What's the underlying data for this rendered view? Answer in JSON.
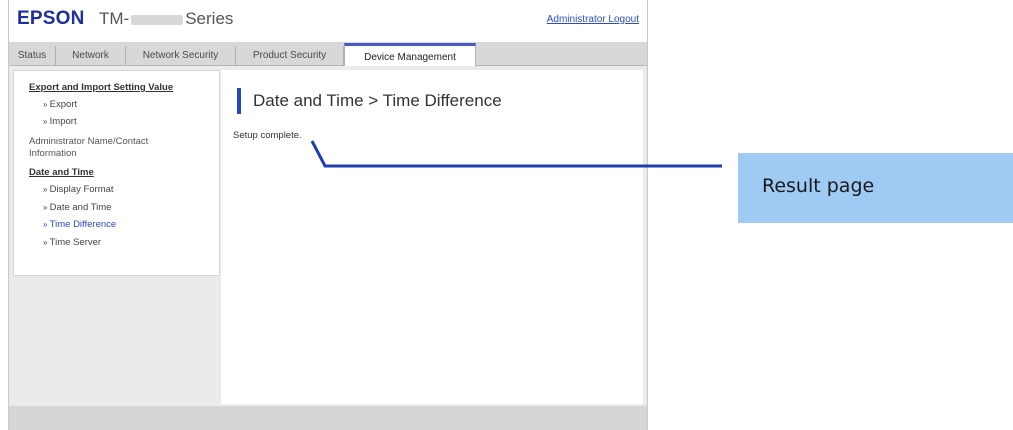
{
  "header": {
    "brand": "EPSON",
    "model_prefix": "TM-",
    "model_suffix": "Series",
    "logout_label": "Administrator Logout"
  },
  "tabs": [
    {
      "label": "Status",
      "active": false
    },
    {
      "label": "Network",
      "active": false
    },
    {
      "label": "Network Security",
      "active": false
    },
    {
      "label": "Product Security",
      "active": false
    },
    {
      "label": "Device Management",
      "active": true
    }
  ],
  "sidebar": {
    "export_import_heading": "Export and Import Setting Value",
    "export_label": "Export",
    "import_label": "Import",
    "admin_info_label": "Administrator Name/Contact Information",
    "date_time_heading": "Date and Time",
    "display_format_label": "Display Format",
    "date_and_time_label": "Date and Time",
    "time_difference_label": "Time Difference",
    "time_server_label": "Time Server"
  },
  "main": {
    "title": "Date and Time > Time Difference",
    "message": "Setup complete."
  },
  "callout": {
    "label": "Result page"
  },
  "colors": {
    "brand": "#1c2f9c",
    "accent_bar": "#2747b8",
    "link": "#2b4bc4",
    "callout_bg": "#9fcaf4"
  }
}
